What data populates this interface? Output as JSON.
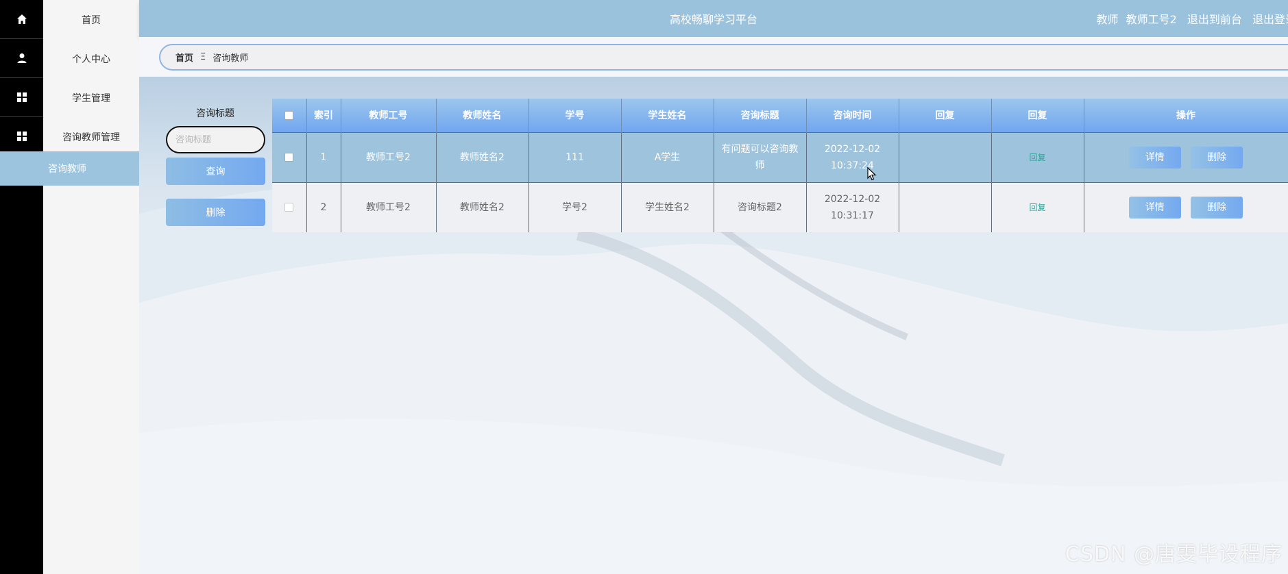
{
  "header": {
    "site_title": "高校畅聊学习平台",
    "user_role": "教师",
    "user_id": "教师工号2",
    "exit_frontend": "退出到前台",
    "logout": "退出登录"
  },
  "sidebar": {
    "rail_icons": [
      "home-icon",
      "user-icon",
      "grid-icon",
      "grid-icon"
    ],
    "items": [
      {
        "label": "首页"
      },
      {
        "label": "个人中心"
      },
      {
        "label": "学生管理"
      },
      {
        "label": "咨询教师管理"
      }
    ],
    "active_sub": "咨询教师"
  },
  "breadcrumb": {
    "home": "首页",
    "separator": "Ξ",
    "current": "咨询教师"
  },
  "search": {
    "label": "咨询标题",
    "placeholder": "咨询标题",
    "query_button": "查询",
    "delete_button": "删除"
  },
  "table": {
    "columns": [
      "索引",
      "教师工号",
      "教师姓名",
      "学号",
      "学生姓名",
      "咨询标题",
      "咨询时间",
      "回复",
      "回复",
      "操作"
    ],
    "rows": [
      {
        "index": "1",
        "teacher_id": "教师工号2",
        "teacher_name": "教师姓名2",
        "student_id": "111",
        "student_name": "A学生",
        "title": "有问题可以咨询教师",
        "time": "2022-12-02 10:37:24",
        "reply_text": "",
        "reply_link": "回复",
        "detail": "详情",
        "delete": "删除"
      },
      {
        "index": "2",
        "teacher_id": "教师工号2",
        "teacher_name": "教师姓名2",
        "student_id": "学号2",
        "student_name": "学生姓名2",
        "title": "咨询标题2",
        "time": "2022-12-02 10:31:17",
        "reply_text": "",
        "reply_link": "回复",
        "detail": "详情",
        "delete": "删除"
      }
    ]
  },
  "watermark": "CSDN @唐雯毕设程序",
  "colors": {
    "header": "#9bc2dc",
    "accent_blue": "#74a9f0",
    "active_menu": "#9cc4de",
    "reply_link": "#2aa89a"
  }
}
